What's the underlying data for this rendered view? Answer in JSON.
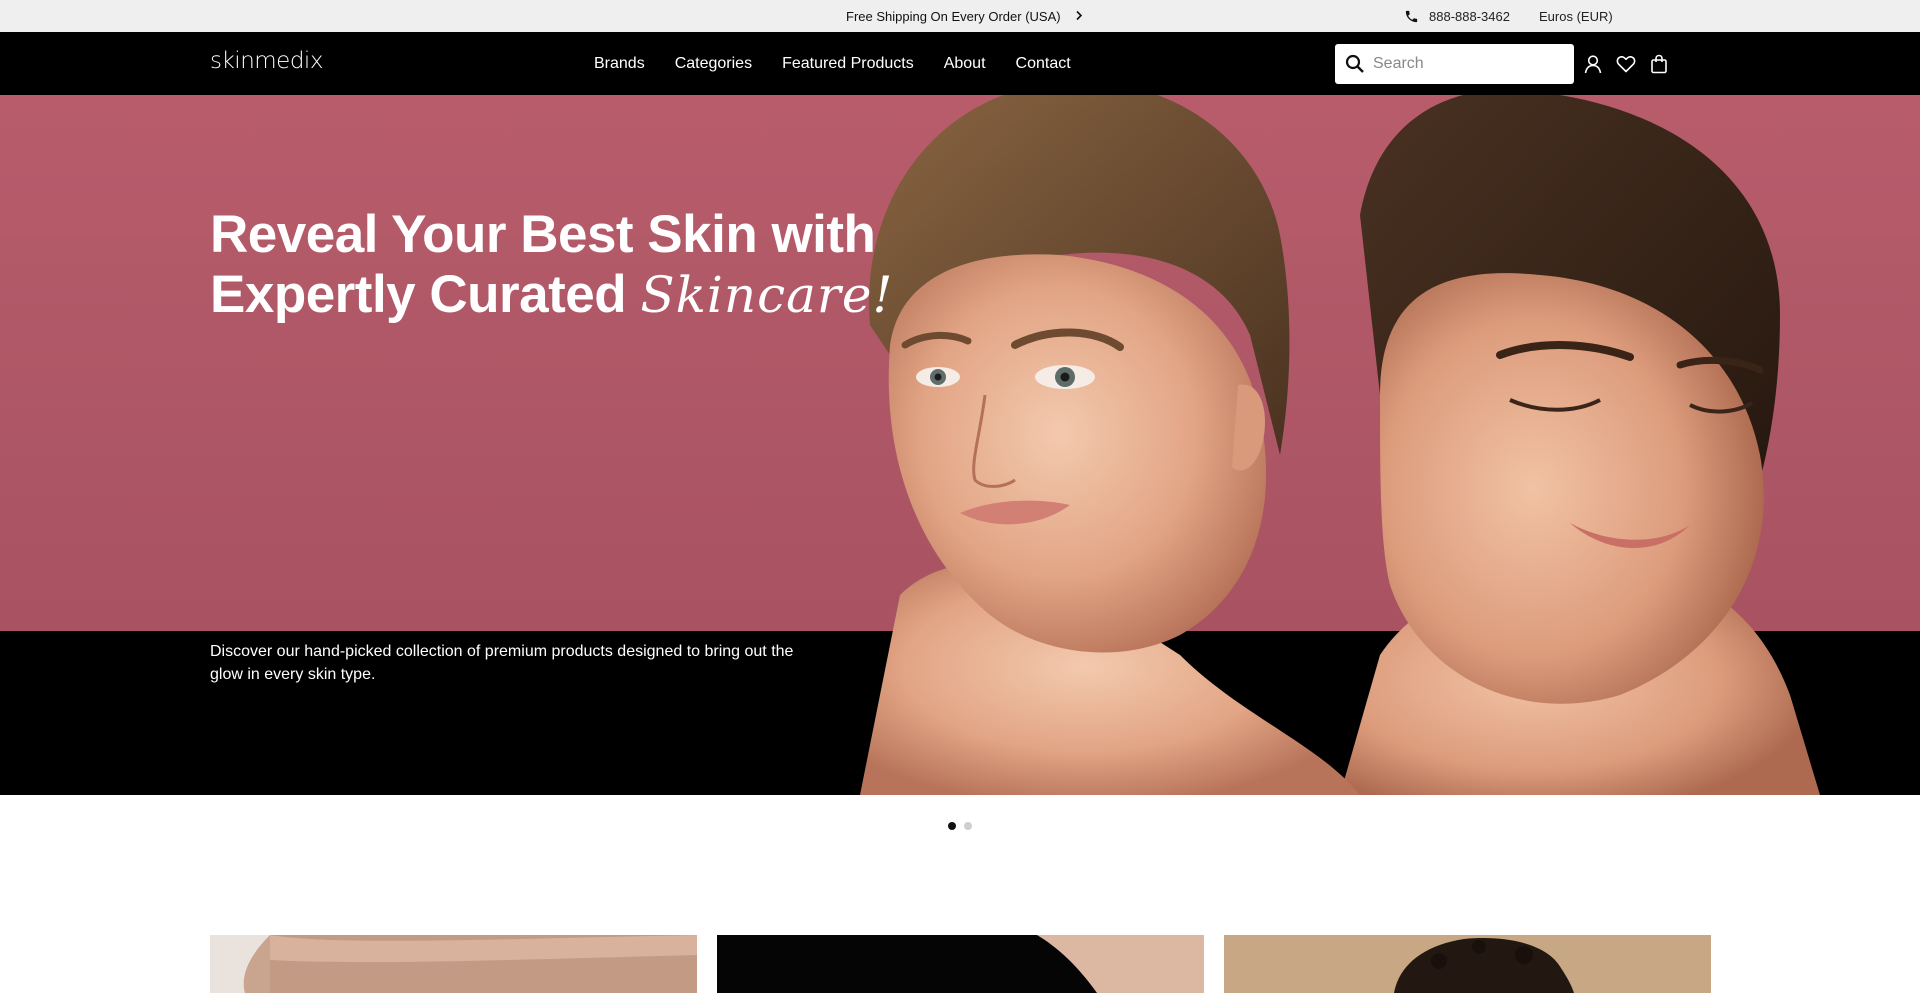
{
  "announcement": {
    "promo_text": "Free Shipping On Every Order (USA)",
    "phone": "888-888-3462",
    "currency": "Euros (EUR)"
  },
  "header": {
    "logo": "skinmedix",
    "nav": [
      "Brands",
      "Categories",
      "Featured Products",
      "About",
      "Contact"
    ],
    "search_placeholder": "Search"
  },
  "hero": {
    "title_line1": "Reveal Your Best Skin with",
    "title_line2": "Expertly Curated",
    "title_script": "Skincare!",
    "description": "Discover our hand-picked collection of premium products designed to bring out the glow in every skin type."
  },
  "carousel": {
    "slides": 2,
    "active": 1
  },
  "icons": [
    "chevron-right-icon",
    "phone-icon",
    "search-icon",
    "account-icon",
    "heart-icon",
    "bag-icon"
  ],
  "colors": {
    "hero_background": "#b05867",
    "header_background": "#000000",
    "topbar_background": "#efefef"
  }
}
